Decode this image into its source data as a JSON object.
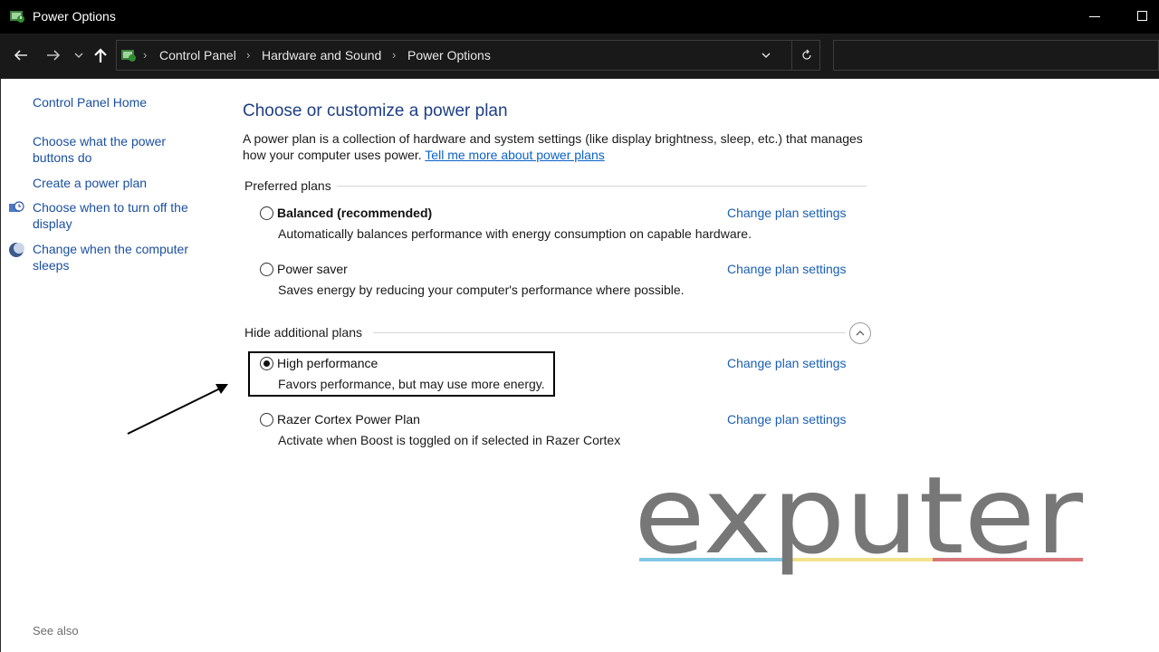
{
  "window": {
    "title": "Power Options",
    "app_icon": "power-options-icon",
    "minimize_icon": "minimize-icon",
    "maximize_icon": "maximize-icon"
  },
  "navigation": {
    "back_icon": "arrow-left-icon",
    "forward_icon": "arrow-right-icon",
    "recent_icon": "chevron-down-icon",
    "up_icon": "arrow-up-icon",
    "breadcrumbs": [
      "Control Panel",
      "Hardware and Sound",
      "Power Options"
    ],
    "dropdown_icon": "chevron-down-icon",
    "refresh_icon": "refresh-icon",
    "search_value": ""
  },
  "sidebar": {
    "home": "Control Panel Home",
    "links": [
      {
        "label": "Choose what the power buttons do",
        "icon": ""
      },
      {
        "label": "Create a power plan",
        "icon": ""
      },
      {
        "label": "Choose when to turn off the display",
        "icon": "display-clock-icon"
      },
      {
        "label": "Change when the computer sleeps",
        "icon": "moon-sleep-icon"
      }
    ],
    "see_also": "See also"
  },
  "main": {
    "title": "Choose or customize a power plan",
    "description": "A power plan is a collection of hardware and system settings (like display brightness, sleep, etc.) that manages how your computer uses power.",
    "learn_more": "Tell me more about power plans",
    "preferred_heading": "Preferred plans",
    "additional_heading": "Hide additional plans",
    "collapse_icon": "chevron-up-circle-icon",
    "change_label": "Change plan settings",
    "plans": [
      {
        "name": "Balanced (recommended)",
        "description": "Automatically balances performance with energy consumption on capable hardware.",
        "selected": false
      },
      {
        "name": "Power saver",
        "description": "Saves energy by reducing your computer's performance where possible.",
        "selected": false
      },
      {
        "name": "High performance",
        "description": "Favors performance, but may use more energy.",
        "selected": true
      },
      {
        "name": "Razer Cortex Power Plan",
        "description": "Activate when Boost is toggled on if selected in Razer Cortex",
        "selected": false
      }
    ]
  },
  "watermark": {
    "text": "exputer",
    "colors": [
      "#7ec8e3",
      "#f2e38a",
      "#d9787a"
    ]
  }
}
